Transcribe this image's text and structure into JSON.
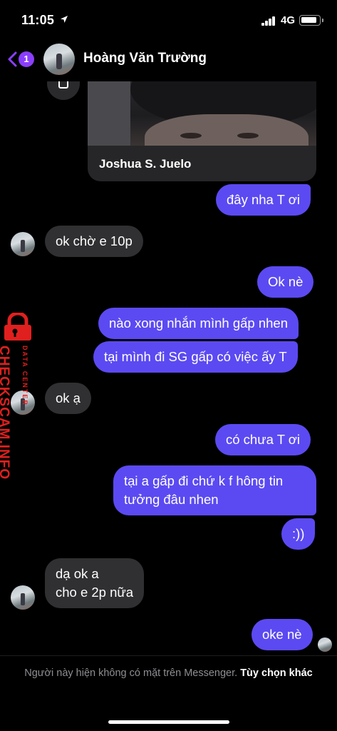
{
  "status_bar": {
    "time": "11:05",
    "network": "4G",
    "battery_percent": 85
  },
  "header": {
    "back_badge": "1",
    "contact_name": "Hoàng Văn Trường"
  },
  "shared_card": {
    "name": "Joshua S. Juelo"
  },
  "messages": [
    {
      "dir": "out",
      "text": "đây nha T ơi"
    },
    {
      "dir": "in",
      "text": "ok chờ e 10p"
    },
    {
      "dir": "out",
      "text": "Ok nè"
    },
    {
      "dir": "out",
      "text": "nào xong nhắn mình gấp nhen"
    },
    {
      "dir": "out",
      "text": "tại mình đi SG gấp có việc ấy T"
    },
    {
      "dir": "in",
      "text": "ok ạ"
    },
    {
      "dir": "out",
      "text": "có chưa T ơi"
    },
    {
      "dir": "out",
      "lines": [
        "tại a gấp đi chứ k f hông tin",
        "tưởng đâu nhen"
      ]
    },
    {
      "dir": "out",
      "text": ":))"
    },
    {
      "dir": "in",
      "lines": [
        "dạ ok a",
        "cho e 2p nữa"
      ]
    },
    {
      "dir": "out",
      "text": "oke nè"
    }
  ],
  "watermark": {
    "main": "CHECKSCAM.INFO",
    "sub": "DATA CENTER"
  },
  "footer": {
    "notice": "Người này hiện không có mặt trên Messenger.",
    "option": "Tùy chọn khác"
  },
  "colors": {
    "outgoing_bubble": "#5b4af2",
    "incoming_bubble": "#303032",
    "badge": "#8a3ffc",
    "watermark": "#e0201e"
  }
}
